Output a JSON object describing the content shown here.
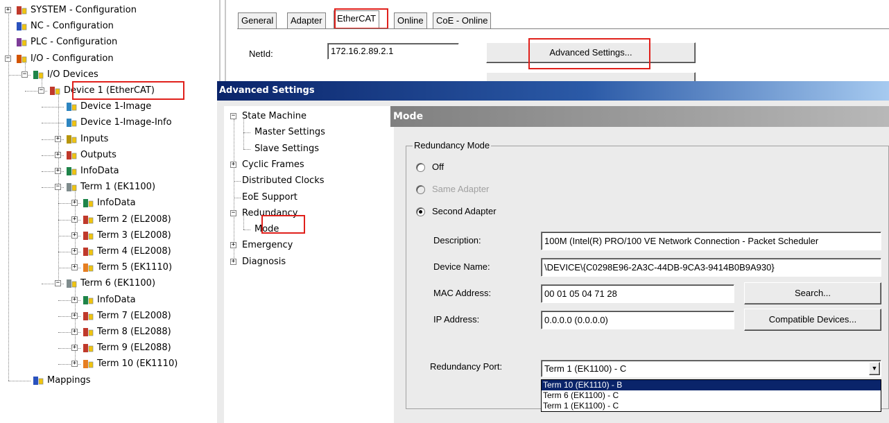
{
  "tree": {
    "items": [
      {
        "label": "SYSTEM - Configuration",
        "expander": "+",
        "icon": "system-config-icon"
      },
      {
        "label": "NC - Configuration",
        "expander": "",
        "icon": "nc-config-icon"
      },
      {
        "label": "PLC - Configuration",
        "expander": "",
        "icon": "plc-config-icon"
      },
      {
        "label": "I/O - Configuration",
        "expander": "−",
        "icon": "io-config-icon"
      },
      {
        "label": "I/O Devices",
        "expander": "−",
        "icon": "io-devices-icon"
      },
      {
        "label": "Device 1 (EtherCAT)",
        "expander": "−",
        "icon": "ethercat-device-icon"
      },
      {
        "label": "Device 1-Image",
        "expander": "",
        "icon": "image-icon"
      },
      {
        "label": "Device 1-Image-Info",
        "expander": "",
        "icon": "image-info-icon"
      },
      {
        "label": "Inputs",
        "expander": "+",
        "icon": "inputs-icon"
      },
      {
        "label": "Outputs",
        "expander": "+",
        "icon": "outputs-icon"
      },
      {
        "label": "InfoData",
        "expander": "+",
        "icon": "infodata-icon"
      },
      {
        "label": "Term 1 (EK1100)",
        "expander": "−",
        "icon": "coupler-icon"
      },
      {
        "label": "InfoData",
        "expander": "+",
        "icon": "infodata-icon"
      },
      {
        "label": "Term 2 (EL2008)",
        "expander": "+",
        "icon": "terminal-icon"
      },
      {
        "label": "Term 3 (EL2008)",
        "expander": "+",
        "icon": "terminal-icon"
      },
      {
        "label": "Term 4 (EL2008)",
        "expander": "+",
        "icon": "terminal-icon"
      },
      {
        "label": "Term 5 (EK1110)",
        "expander": "+",
        "icon": "extension-terminal-icon"
      },
      {
        "label": "Term 6 (EK1100)",
        "expander": "−",
        "icon": "coupler-icon"
      },
      {
        "label": "InfoData",
        "expander": "+",
        "icon": "infodata-icon"
      },
      {
        "label": "Term 7 (EL2008)",
        "expander": "+",
        "icon": "terminal-icon"
      },
      {
        "label": "Term 8 (EL2088)",
        "expander": "+",
        "icon": "terminal-icon"
      },
      {
        "label": "Term 9 (EL2088)",
        "expander": "+",
        "icon": "terminal-icon"
      },
      {
        "label": "Term 10 (EK1110)",
        "expander": "+",
        "icon": "extension-terminal-icon"
      },
      {
        "label": "Mappings",
        "expander": "",
        "icon": "mappings-icon"
      }
    ]
  },
  "tabs": [
    {
      "label": "General"
    },
    {
      "label": "Adapter"
    },
    {
      "label": "EtherCAT"
    },
    {
      "label": "Online"
    },
    {
      "label": "CoE - Online"
    }
  ],
  "netid": {
    "label": "NetId:",
    "value": "172.16.2.89.2.1"
  },
  "advanced_button": "Advanced Settings...",
  "dialog": {
    "title": "Advanced Settings",
    "nav": [
      {
        "label": "State Machine",
        "expander": "−"
      },
      {
        "label": "Master Settings",
        "expander": ""
      },
      {
        "label": "Slave Settings",
        "expander": ""
      },
      {
        "label": "Cyclic Frames",
        "expander": "+"
      },
      {
        "label": "Distributed Clocks",
        "expander": ""
      },
      {
        "label": "EoE Support",
        "expander": ""
      },
      {
        "label": "Redundancy",
        "expander": "−"
      },
      {
        "label": "Mode",
        "expander": ""
      },
      {
        "label": "Emergency",
        "expander": "+"
      },
      {
        "label": "Diagnosis",
        "expander": "+"
      }
    ],
    "header": "Mode",
    "group_title": "Redundancy Mode",
    "radios": [
      {
        "label": "Off",
        "selected": false,
        "disabled": false
      },
      {
        "label": "Same Adapter",
        "selected": false,
        "disabled": true
      },
      {
        "label": "Second Adapter",
        "selected": true,
        "disabled": false
      }
    ],
    "fields": {
      "description": {
        "label": "Description:",
        "value": "100M (Intel(R) PRO/100 VE Network Connection - Packet Scheduler"
      },
      "device_name": {
        "label": "Device Name:",
        "value": "\\DEVICE\\{C0298E96-2A3C-44DB-9CA3-9414B0B9A930}"
      },
      "mac": {
        "label": "MAC Address:",
        "value": "00 01 05 04 71 28"
      },
      "ip": {
        "label": "IP Address:",
        "value": "0.0.0.0 (0.0.0.0)"
      }
    },
    "search_button": "Search...",
    "compatible_button": "Compatible Devices...",
    "redundancy_port": {
      "label": "Redundancy Port:",
      "value": "Term 1 (EK1100) - C",
      "options": [
        "Term 10 (EK1110) - B",
        "Term 6 (EK1100) - C",
        "Term 1 (EK1100) - C"
      ]
    }
  }
}
